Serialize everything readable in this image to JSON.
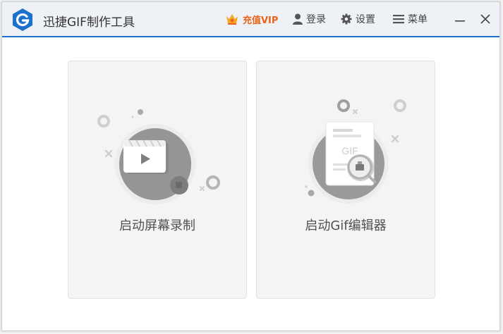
{
  "app": {
    "title": "迅捷GIF制作工具",
    "logo_icon": "gif-logo-icon",
    "brand_color": "#1e6fcf"
  },
  "toolbar": {
    "vip_label": "充值VIP",
    "vip_color": "#e8641c",
    "login_label": "登录",
    "settings_label": "设置",
    "menu_label": "菜单",
    "minimize_icon": "minimize-icon",
    "close_icon": "close-icon"
  },
  "cards": [
    {
      "label": "启动屏幕录制",
      "icon": "video-play-icon"
    },
    {
      "label": "启动Gif编辑器",
      "icon": "gif-document-search-icon"
    }
  ]
}
